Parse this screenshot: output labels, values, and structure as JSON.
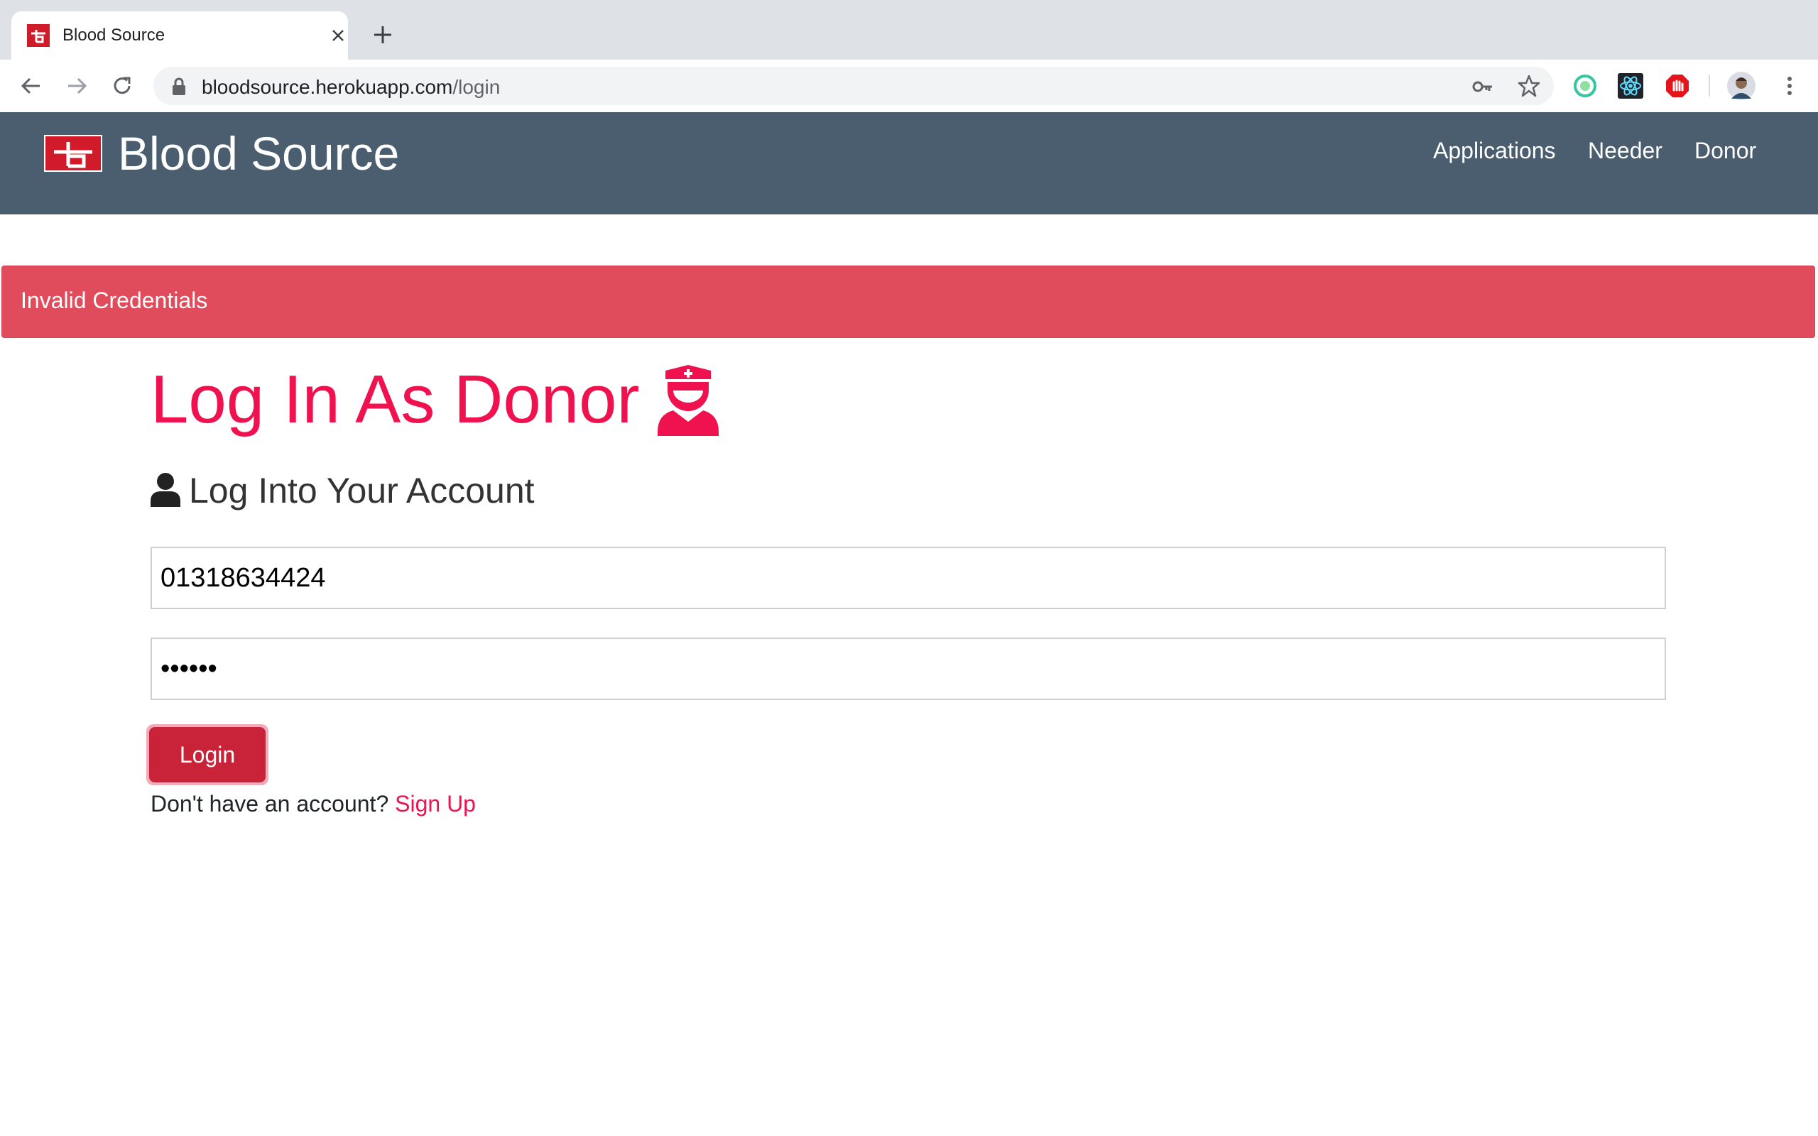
{
  "browser": {
    "tab_title": "Blood Source",
    "url_host": "bloodsource.herokuapp.com",
    "url_path": "/login",
    "icons": [
      "back-icon",
      "forward-icon",
      "reload-icon",
      "lock-icon",
      "key-icon",
      "star-icon",
      "extension-icon",
      "react-devtools-icon",
      "adblock-icon",
      "profile-avatar",
      "menu-icon"
    ]
  },
  "navbar": {
    "brand": "Blood Source",
    "links": [
      "Applications",
      "Needer",
      "Donor"
    ],
    "background": "#4b5e70"
  },
  "alert": {
    "message": "Invalid Credentials",
    "color": "#e04c5c"
  },
  "form": {
    "title": "Log In As Donor",
    "subtitle": "Log Into Your Account",
    "phone_value": "01318634424",
    "password_value": "••••••",
    "login_label": "Login",
    "no_account_text": "Don't have an account?",
    "signup_label": "Sign Up",
    "accent": "#f0124f"
  }
}
